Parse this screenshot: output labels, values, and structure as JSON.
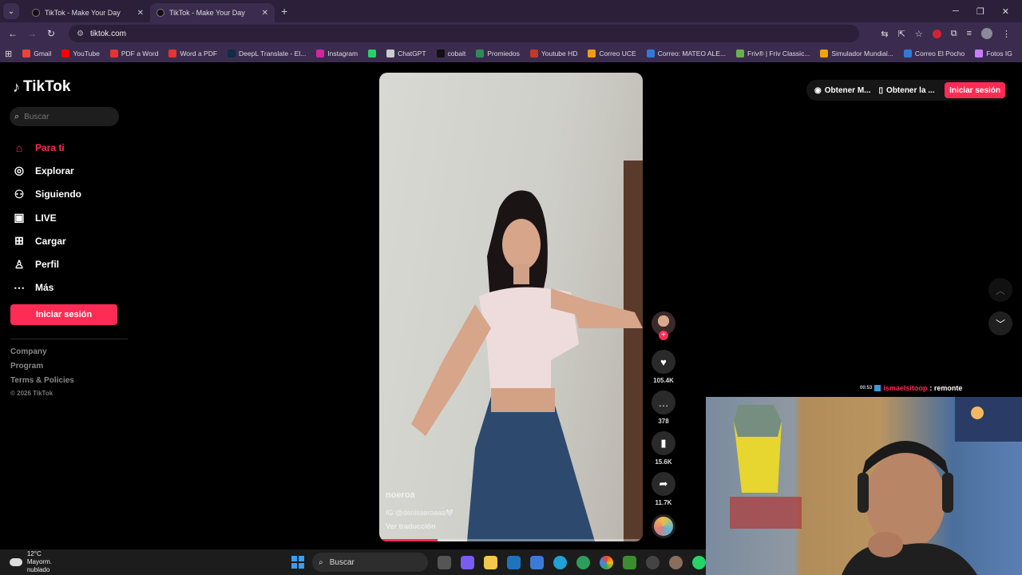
{
  "browser": {
    "tabs": [
      {
        "title": "TikTok - Make Your Day",
        "active": false
      },
      {
        "title": "TikTok - Make Your Day",
        "active": true
      }
    ],
    "url": "tiktok.com",
    "bookmarks": [
      {
        "label": "Gmail",
        "icon": "gmail-icon",
        "color": "#ea4335"
      },
      {
        "label": "YouTube",
        "icon": "youtube-icon",
        "color": "#ff0000"
      },
      {
        "label": "PDF a Word",
        "icon": "pdf-icon",
        "color": "#e3342f"
      },
      {
        "label": "Word a PDF",
        "icon": "pdf-icon",
        "color": "#e3342f"
      },
      {
        "label": "DeepL Translate - El...",
        "icon": "deepl-icon",
        "color": "#0f2b46"
      },
      {
        "label": "Instagram",
        "icon": "instagram-icon",
        "color": "#d6249f"
      },
      {
        "label": "",
        "icon": "whatsapp-icon",
        "color": "#25d366"
      },
      {
        "label": "ChatGPT",
        "icon": "chatgpt-icon",
        "color": "#cccccc"
      },
      {
        "label": "cobalt",
        "icon": "cobalt-icon",
        "color": "#111111"
      },
      {
        "label": "Promiedos",
        "icon": "promiedos-icon",
        "color": "#2e8b57"
      },
      {
        "label": "Youtube HD",
        "icon": "image-icon",
        "color": "#c0392b"
      },
      {
        "label": "Correo UCE",
        "icon": "mail-icon",
        "color": "#f39c12"
      },
      {
        "label": "Correo: MATEO ALE...",
        "icon": "outlook-icon",
        "color": "#2f7ad9"
      },
      {
        "label": "Friv® | Friv Classic...",
        "icon": "friv-icon",
        "color": "#6ab04c"
      },
      {
        "label": "Simulador Mundial...",
        "icon": "app-icon",
        "color": "#f0a500"
      },
      {
        "label": "Correo El Pocho",
        "icon": "outlook-icon",
        "color": "#2f7ad9"
      },
      {
        "label": "Fotos IG",
        "icon": "folder-icon",
        "color": "#c77dff"
      }
    ]
  },
  "tiktok": {
    "logo": "TikTok",
    "search_placeholder": "Buscar",
    "nav": [
      {
        "label": "Para ti",
        "icon": "home-icon",
        "glyph": "⌂",
        "active": true
      },
      {
        "label": "Explorar",
        "icon": "compass-icon",
        "glyph": "◎",
        "active": false
      },
      {
        "label": "Siguiendo",
        "icon": "following-icon",
        "glyph": "⚇",
        "active": false
      },
      {
        "label": "LIVE",
        "icon": "live-icon",
        "glyph": "▣",
        "active": false
      },
      {
        "label": "Cargar",
        "icon": "upload-icon",
        "glyph": "⊞",
        "active": false
      },
      {
        "label": "Perfil",
        "icon": "profile-icon",
        "glyph": "♙",
        "active": false
      },
      {
        "label": "Más",
        "icon": "more-icon",
        "glyph": "⋯",
        "active": false
      }
    ],
    "login_label": "Iniciar sesión",
    "footer": [
      "Company",
      "Program",
      "Terms & Policies"
    ],
    "copyright": "© 2026 TikTok",
    "top_right": {
      "item1": "Obtener M...",
      "item2": "Obtener la ...",
      "login": "Iniciar sesión"
    },
    "video": {
      "username": "noeroa",
      "caption": "IG:@denisseroaaa🤍",
      "translate": "Ver traducción",
      "progress": 0.22
    },
    "actions": {
      "likes": "105.4K",
      "comments": "378",
      "saves": "15.6K",
      "shares": "11.7K"
    },
    "accent": "#fe2c55"
  },
  "overlay": {
    "chat_time": "00:53",
    "chat_user": "ismaelsitoop",
    "chat_message": ": remonte"
  },
  "taskbar": {
    "temperature": "12°C",
    "weather": "Mayorm. nublado",
    "search": "Buscar"
  }
}
